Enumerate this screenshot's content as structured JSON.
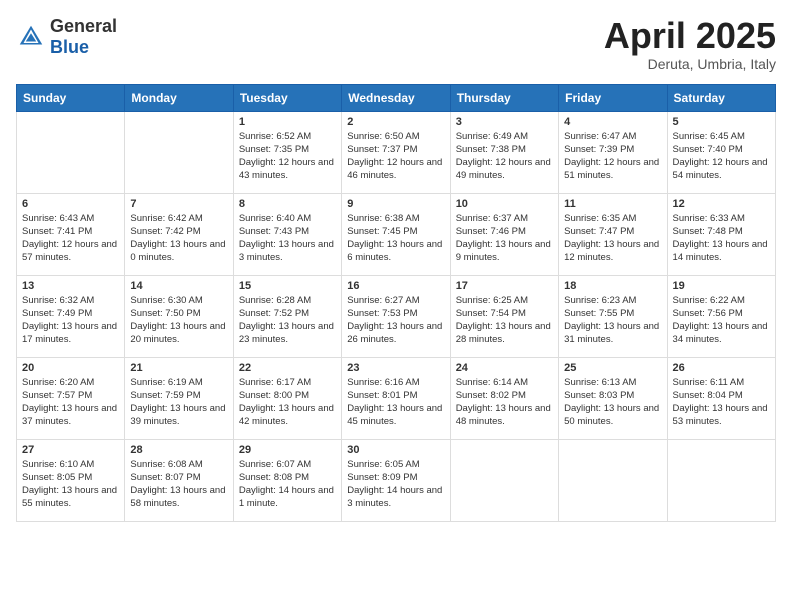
{
  "header": {
    "logo_general": "General",
    "logo_blue": "Blue",
    "title": "April 2025",
    "location": "Deruta, Umbria, Italy"
  },
  "weekdays": [
    "Sunday",
    "Monday",
    "Tuesday",
    "Wednesday",
    "Thursday",
    "Friday",
    "Saturday"
  ],
  "weeks": [
    [
      {
        "day": "",
        "sunrise": "",
        "sunset": "",
        "daylight": ""
      },
      {
        "day": "",
        "sunrise": "",
        "sunset": "",
        "daylight": ""
      },
      {
        "day": "1",
        "sunrise": "Sunrise: 6:52 AM",
        "sunset": "Sunset: 7:35 PM",
        "daylight": "Daylight: 12 hours and 43 minutes."
      },
      {
        "day": "2",
        "sunrise": "Sunrise: 6:50 AM",
        "sunset": "Sunset: 7:37 PM",
        "daylight": "Daylight: 12 hours and 46 minutes."
      },
      {
        "day": "3",
        "sunrise": "Sunrise: 6:49 AM",
        "sunset": "Sunset: 7:38 PM",
        "daylight": "Daylight: 12 hours and 49 minutes."
      },
      {
        "day": "4",
        "sunrise": "Sunrise: 6:47 AM",
        "sunset": "Sunset: 7:39 PM",
        "daylight": "Daylight: 12 hours and 51 minutes."
      },
      {
        "day": "5",
        "sunrise": "Sunrise: 6:45 AM",
        "sunset": "Sunset: 7:40 PM",
        "daylight": "Daylight: 12 hours and 54 minutes."
      }
    ],
    [
      {
        "day": "6",
        "sunrise": "Sunrise: 6:43 AM",
        "sunset": "Sunset: 7:41 PM",
        "daylight": "Daylight: 12 hours and 57 minutes."
      },
      {
        "day": "7",
        "sunrise": "Sunrise: 6:42 AM",
        "sunset": "Sunset: 7:42 PM",
        "daylight": "Daylight: 13 hours and 0 minutes."
      },
      {
        "day": "8",
        "sunrise": "Sunrise: 6:40 AM",
        "sunset": "Sunset: 7:43 PM",
        "daylight": "Daylight: 13 hours and 3 minutes."
      },
      {
        "day": "9",
        "sunrise": "Sunrise: 6:38 AM",
        "sunset": "Sunset: 7:45 PM",
        "daylight": "Daylight: 13 hours and 6 minutes."
      },
      {
        "day": "10",
        "sunrise": "Sunrise: 6:37 AM",
        "sunset": "Sunset: 7:46 PM",
        "daylight": "Daylight: 13 hours and 9 minutes."
      },
      {
        "day": "11",
        "sunrise": "Sunrise: 6:35 AM",
        "sunset": "Sunset: 7:47 PM",
        "daylight": "Daylight: 13 hours and 12 minutes."
      },
      {
        "day": "12",
        "sunrise": "Sunrise: 6:33 AM",
        "sunset": "Sunset: 7:48 PM",
        "daylight": "Daylight: 13 hours and 14 minutes."
      }
    ],
    [
      {
        "day": "13",
        "sunrise": "Sunrise: 6:32 AM",
        "sunset": "Sunset: 7:49 PM",
        "daylight": "Daylight: 13 hours and 17 minutes."
      },
      {
        "day": "14",
        "sunrise": "Sunrise: 6:30 AM",
        "sunset": "Sunset: 7:50 PM",
        "daylight": "Daylight: 13 hours and 20 minutes."
      },
      {
        "day": "15",
        "sunrise": "Sunrise: 6:28 AM",
        "sunset": "Sunset: 7:52 PM",
        "daylight": "Daylight: 13 hours and 23 minutes."
      },
      {
        "day": "16",
        "sunrise": "Sunrise: 6:27 AM",
        "sunset": "Sunset: 7:53 PM",
        "daylight": "Daylight: 13 hours and 26 minutes."
      },
      {
        "day": "17",
        "sunrise": "Sunrise: 6:25 AM",
        "sunset": "Sunset: 7:54 PM",
        "daylight": "Daylight: 13 hours and 28 minutes."
      },
      {
        "day": "18",
        "sunrise": "Sunrise: 6:23 AM",
        "sunset": "Sunset: 7:55 PM",
        "daylight": "Daylight: 13 hours and 31 minutes."
      },
      {
        "day": "19",
        "sunrise": "Sunrise: 6:22 AM",
        "sunset": "Sunset: 7:56 PM",
        "daylight": "Daylight: 13 hours and 34 minutes."
      }
    ],
    [
      {
        "day": "20",
        "sunrise": "Sunrise: 6:20 AM",
        "sunset": "Sunset: 7:57 PM",
        "daylight": "Daylight: 13 hours and 37 minutes."
      },
      {
        "day": "21",
        "sunrise": "Sunrise: 6:19 AM",
        "sunset": "Sunset: 7:59 PM",
        "daylight": "Daylight: 13 hours and 39 minutes."
      },
      {
        "day": "22",
        "sunrise": "Sunrise: 6:17 AM",
        "sunset": "Sunset: 8:00 PM",
        "daylight": "Daylight: 13 hours and 42 minutes."
      },
      {
        "day": "23",
        "sunrise": "Sunrise: 6:16 AM",
        "sunset": "Sunset: 8:01 PM",
        "daylight": "Daylight: 13 hours and 45 minutes."
      },
      {
        "day": "24",
        "sunrise": "Sunrise: 6:14 AM",
        "sunset": "Sunset: 8:02 PM",
        "daylight": "Daylight: 13 hours and 48 minutes."
      },
      {
        "day": "25",
        "sunrise": "Sunrise: 6:13 AM",
        "sunset": "Sunset: 8:03 PM",
        "daylight": "Daylight: 13 hours and 50 minutes."
      },
      {
        "day": "26",
        "sunrise": "Sunrise: 6:11 AM",
        "sunset": "Sunset: 8:04 PM",
        "daylight": "Daylight: 13 hours and 53 minutes."
      }
    ],
    [
      {
        "day": "27",
        "sunrise": "Sunrise: 6:10 AM",
        "sunset": "Sunset: 8:05 PM",
        "daylight": "Daylight: 13 hours and 55 minutes."
      },
      {
        "day": "28",
        "sunrise": "Sunrise: 6:08 AM",
        "sunset": "Sunset: 8:07 PM",
        "daylight": "Daylight: 13 hours and 58 minutes."
      },
      {
        "day": "29",
        "sunrise": "Sunrise: 6:07 AM",
        "sunset": "Sunset: 8:08 PM",
        "daylight": "Daylight: 14 hours and 1 minute."
      },
      {
        "day": "30",
        "sunrise": "Sunrise: 6:05 AM",
        "sunset": "Sunset: 8:09 PM",
        "daylight": "Daylight: 14 hours and 3 minutes."
      },
      {
        "day": "",
        "sunrise": "",
        "sunset": "",
        "daylight": ""
      },
      {
        "day": "",
        "sunrise": "",
        "sunset": "",
        "daylight": ""
      },
      {
        "day": "",
        "sunrise": "",
        "sunset": "",
        "daylight": ""
      }
    ]
  ]
}
